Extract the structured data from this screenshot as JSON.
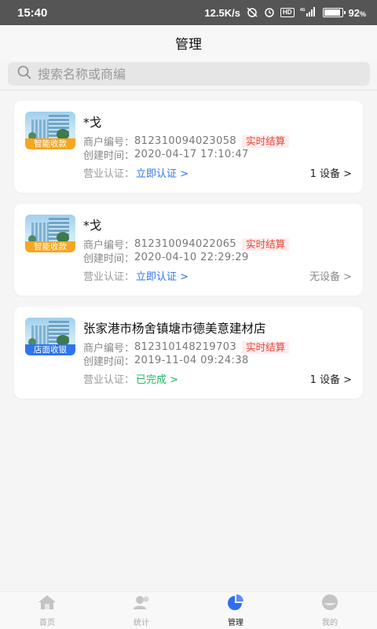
{
  "status_bar": {
    "time": "15:40",
    "network_speed": "12.5K/s",
    "battery_percent": "92",
    "battery_unit": "%",
    "hd_label": "HD",
    "signal_label": "4G",
    "battery_level": 0.92
  },
  "header": {
    "title": "管理"
  },
  "search": {
    "placeholder": "搜索名称或商编",
    "value": ""
  },
  "merchants": [
    {
      "name": "*戈",
      "tag": "智能收款",
      "tag_color": "#f5a623",
      "merchant_no_label": "商户编号：",
      "merchant_no": "812310094023058",
      "settle_badge": "实时结算",
      "created_label": "创建时间：",
      "created_time": "2020-04-17 17:10:47",
      "cert_label": "营业认证：",
      "cert_status": "立即认证 >",
      "device": "1 设备 >"
    },
    {
      "name": "*戈",
      "tag": "智能收款",
      "tag_color": "#f5a623",
      "merchant_no_label": "商户编号：",
      "merchant_no": "812310094022065",
      "settle_badge": "实时结算",
      "created_label": "创建时间：",
      "created_time": "2020-04-10 22:29:29",
      "cert_label": "营业认证：",
      "cert_status": "立即认证 >",
      "device": "无设备 >"
    },
    {
      "name": "张家港市杨舍镇塘市德美意建材店",
      "tag": "店面收银",
      "tag_color": "#2e74f0",
      "merchant_no_label": "商户编号：",
      "merchant_no": "812310148219703",
      "settle_badge": "实时结算",
      "created_label": "创建时间：",
      "created_time": "2019-11-04 09:24:38",
      "cert_label": "营业认证：",
      "cert_status": "已完成 >",
      "device": "1 设备 >"
    }
  ],
  "tabbar": {
    "tabs": [
      {
        "label": "首页",
        "icon": "home-icon",
        "active": false
      },
      {
        "label": "统计",
        "icon": "statistics-icon",
        "active": false
      },
      {
        "label": "管理",
        "icon": "pie-chart-icon",
        "active": true
      },
      {
        "label": "我的",
        "icon": "profile-icon",
        "active": false
      }
    ]
  },
  "colors": {
    "accent_blue": "#2e74f0",
    "success_green": "#25b864",
    "badge_red": "#e5473b",
    "tag_orange": "#f5a623"
  }
}
